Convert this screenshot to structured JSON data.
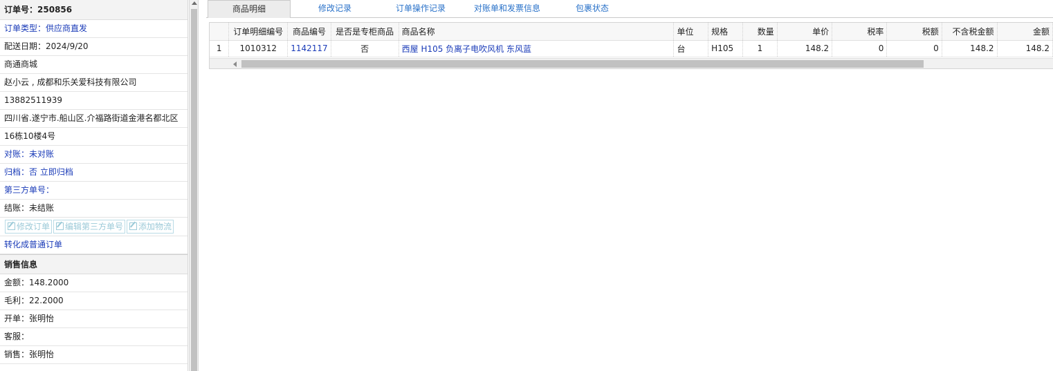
{
  "left": {
    "order_no_label": "订单号：",
    "order_no": "250856",
    "order_type_label": "订单类型：",
    "order_type": "供应商直发",
    "delivery_date_label": "配送日期：",
    "delivery_date": "2024/9/20",
    "mall": "商通商城",
    "customer": "赵小云 , 成都和乐关爱科技有限公司",
    "phone": "13882511939",
    "address_line1": "四川省.遂宁市.船山区.介福路街道金港名都北区",
    "address_line2": "16栋10楼4号",
    "reconcile_label": "对账：",
    "reconcile_value": "未对账",
    "archive_label": "归档：",
    "archive_value": "否",
    "archive_link": "立即归档",
    "third_party_label": "第三方单号：",
    "settle_label": "结账：",
    "settle_value": "未结账",
    "buttons": {
      "edit_order": "修改订单",
      "edit_third_party": "编辑第三方单号",
      "add_logistics": "添加物流"
    },
    "convert_link": "转化成普通订单",
    "sales_section_title": "销售信息",
    "amount_label": "金额：",
    "amount": "148.2000",
    "gross_label": "毛利：",
    "gross": "22.2000",
    "opener_label": "开单：",
    "opener": "张明怡",
    "service_label": "客服：",
    "service": "",
    "sales_label": "销售：",
    "sales": "张明怡"
  },
  "tabs": [
    {
      "label": "商品明细",
      "active": true
    },
    {
      "label": "修改记录",
      "active": false
    },
    {
      "label": "订单操作记录",
      "active": false
    },
    {
      "label": "对账单和发票信息",
      "active": false
    },
    {
      "label": "包裹状态",
      "active": false
    }
  ],
  "table": {
    "headers": [
      "",
      "订单明细编号",
      "商品编号",
      "是否是专柜商品",
      "商品名称",
      "单位",
      "规格",
      "数量",
      "单价",
      "税率",
      "税额",
      "不含税金额",
      "金额"
    ],
    "rows": [
      [
        "1",
        "1010312",
        "1142117",
        "否",
        "西屋 H105 负离子电吹风机 东风蓝",
        "台",
        "H105",
        "1",
        "148.2",
        "0",
        "0",
        "148.2",
        "148.2"
      ]
    ]
  },
  "colors": {
    "link": "#1a3bb8",
    "tab_text": "#2a72c9",
    "disabled_button": "#9ccad8"
  }
}
